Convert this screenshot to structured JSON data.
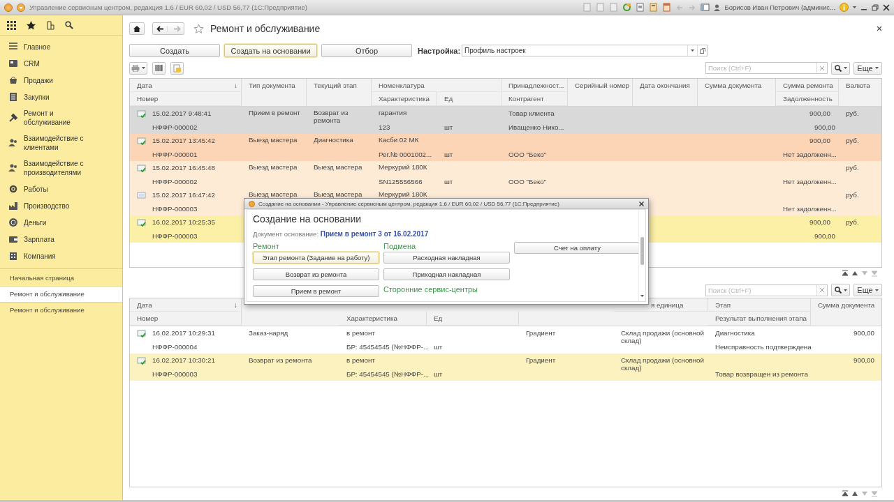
{
  "window": {
    "title": "Управление сервисным центром, редакция 1.6 / EUR 60,02 / USD 56,77  (1С:Предприятие)",
    "user": "Борисов Иван Петрович (админис..."
  },
  "sidebar": {
    "sections": [
      {
        "label": "Главное"
      },
      {
        "label": "CRM"
      },
      {
        "label": "Продажи"
      },
      {
        "label": "Закупки"
      },
      {
        "label": "Ремонт и обслуживание"
      },
      {
        "label": "Взаимодействие с клиентами"
      },
      {
        "label": "Взаимодействие с производителями"
      },
      {
        "label": "Работы"
      },
      {
        "label": "Производство"
      },
      {
        "label": "Деньги"
      },
      {
        "label": "Зарплата"
      },
      {
        "label": "Компания"
      }
    ],
    "open_windows": [
      {
        "label": "Начальная страница",
        "selected": false
      },
      {
        "label": "Ремонт и обслуживание",
        "selected": true
      },
      {
        "label": "Ремонт и обслуживание",
        "selected": false
      }
    ]
  },
  "page": {
    "title": "Ремонт и обслуживание",
    "buttons": [
      {
        "label": "Создать",
        "focused": false
      },
      {
        "label": "Создать на основании",
        "focused": true
      },
      {
        "label": "Отбор",
        "focused": false
      }
    ],
    "settings_label": "Настройка:",
    "settings_value": "Профиль настроек",
    "search_placeholder": "Поиск (Ctrl+F)",
    "more": "Еще"
  },
  "top_table": {
    "columns": [
      {
        "label": "Дата",
        "sort_mark": "↓"
      },
      {
        "label": "Номер"
      },
      {
        "label": "Тип документа"
      },
      {
        "label": "Текущий этап"
      },
      {
        "label": "Номенклатура"
      },
      {
        "label": "Характеристика"
      },
      {
        "label": "Ед"
      },
      {
        "label": "Принадлежност..."
      },
      {
        "label": "Контрагент"
      },
      {
        "label": "Серийный номер"
      },
      {
        "label": "Дата окончания"
      },
      {
        "label": "Сумма документа"
      },
      {
        "label": "Сумма ремонта"
      },
      {
        "label": "Задолженность"
      },
      {
        "label": "Валюта"
      }
    ],
    "rows": [
      {
        "color": "#d9d9d9",
        "posted": true,
        "date": "15.02.2017 9:48:41",
        "number": "НФФР-000002",
        "doc_type": "Прием в ремонт",
        "stage": "Возврат из ремонта",
        "nomenclature": "гарантия",
        "characteristic": "123",
        "unit": "шт",
        "ownership": "Товар клиента",
        "counterparty": "Иващенко Нико...",
        "repair_sum": "900,00",
        "debt": "900,00",
        "currency": "руб."
      },
      {
        "color": "#fcd5b6",
        "posted": true,
        "date": "15.02.2017 13:45:42",
        "number": "НФФР-000001",
        "doc_type": "Выезд мастера",
        "stage": "Диагностика",
        "nomenclature": "Касби 02 МК",
        "characteristic": "Рег.№ 0001002...",
        "unit": "шт",
        "counterparty": "ООО \"Беко\"",
        "repair_sum": "900,00",
        "debt": "Нет задолженн...",
        "currency": "руб."
      },
      {
        "color": "#fdebd6",
        "posted": true,
        "date": "15.02.2017 16:45:48",
        "number": "НФФР-000002",
        "doc_type": "Выезд мастера",
        "stage": "Выезд мастера",
        "nomenclature": "Меркурий 180К",
        "characteristic": "SN125556566",
        "unit": "шт",
        "counterparty": "ООО \"Беко\"",
        "debt": "Нет задолженн...",
        "currency": "руб."
      },
      {
        "color": "#fdebd6",
        "posted": false,
        "date": "15.02.2017 16:47:42",
        "number": "НФФР-000003",
        "doc_type": "Выезд мастера",
        "stage": "Выезд мастера",
        "nomenclature": "Меркурий 180К",
        "debt": "Нет задолженн...",
        "currency": "руб."
      },
      {
        "color": "#fcefa6",
        "posted": true,
        "date": "16.02.2017 10:25:35",
        "number": "НФФР-000003",
        "repair_sum": "900,00",
        "debt": "900,00",
        "currency": "руб."
      }
    ]
  },
  "bottom_panel": {
    "search_placeholder": "Поиск (Ctrl+F)",
    "more": "Еще"
  },
  "bottom_table": {
    "columns": [
      {
        "label": "Дата",
        "sort_mark": "↓"
      },
      {
        "label": "Номер"
      },
      {
        "label": "Характеристика"
      },
      {
        "label": "Ед"
      },
      {
        "label": "я единица"
      },
      {
        "label": "Этап"
      },
      {
        "label": "Результат выполнения этапа"
      },
      {
        "label": "Сумма документа"
      }
    ],
    "rows": [
      {
        "selected": false,
        "date": "16.02.2017 10:29:31",
        "number": "НФФР-000004",
        "column_2": "Заказ-наряд",
        "column_3": "в ремонт",
        "characteristic": "БР: 45454545 (№НФФР-...",
        "unit": "шт",
        "column_5": "Градиент",
        "column_6": "Склад продажи (основной склад)",
        "stage": "Диагностика",
        "result": "Неисправность подтверждена",
        "doc_sum": "900,00"
      },
      {
        "selected": true,
        "date": "16.02.2017 10:30:21",
        "number": "НФФР-000003",
        "column_2": "Возврат из ремонта",
        "column_3": "в ремонт",
        "characteristic": "БР: 45454545 (№НФФР-...",
        "unit": "шт",
        "column_5": "Градиент",
        "column_6": "Склад продажи (основной склад)",
        "result": "Товар возвращен из ремонта",
        "doc_sum": "900,00"
      }
    ]
  },
  "dialog": {
    "title": "Создание на основании - Управление сервисным центром, редакция 1.6 / EUR 60,02 / USD 56,77  (1С:Предприятие)",
    "heading": "Создание на основании",
    "basis_label": "Документ основание:",
    "basis_link": "Прием в ремонт 3 от 16.02.2017",
    "columns": [
      [
        {
          "title": "Ремонт",
          "buttons": [
            {
              "label": "Этап ремонта (Задание на работу)",
              "focused": true
            },
            {
              "label": "Возврат из ремонта",
              "focused": false
            },
            {
              "label": "Прием в ремонт",
              "focused": false
            }
          ]
        }
      ],
      [
        {
          "title": "Подмена",
          "buttons": [
            {
              "label": "Расходная накладная",
              "focused": false
            },
            {
              "label": "Приходная накладная",
              "focused": false
            }
          ]
        },
        {
          "title": "Сторонние сервис-центры"
        }
      ],
      [
        {
          "buttons": [
            {
              "label": "Счет на оплату",
              "focused": false
            }
          ]
        }
      ]
    ]
  }
}
